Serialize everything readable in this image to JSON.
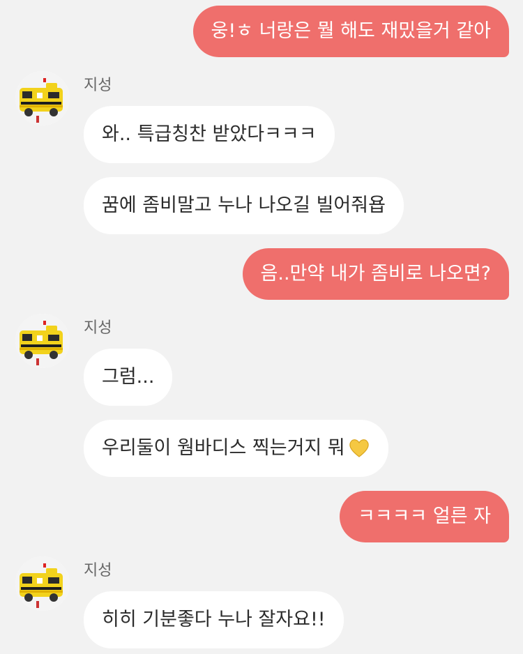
{
  "chat": {
    "sender_name": "지성",
    "colors": {
      "my_bubble": "#ef6f6c",
      "their_bubble": "#ffffff",
      "background": "#f2f2f2"
    },
    "messages": [
      {
        "from": "me",
        "text": "웅!ㅎ 너랑은 뭘 해도 재밌을거 같아"
      },
      {
        "from": "them",
        "text": "와.. 특급칭찬 받았다ㅋㅋㅋ"
      },
      {
        "from": "them",
        "text": "꿈에 좀비말고 누나 나오길 빌어줘욥"
      },
      {
        "from": "me",
        "text": "음..만약 내가 좀비로 나오면?"
      },
      {
        "from": "them",
        "text": "그럼..."
      },
      {
        "from": "them",
        "text": "우리둘이 웜바디스 찍는거지 뭐",
        "emoji": "yellow-heart-icon"
      },
      {
        "from": "me",
        "text": "ㅋㅋㅋㅋ 얼른 자"
      },
      {
        "from": "them",
        "text": "히히 기분좋다 누나 잘자요!!"
      }
    ]
  }
}
